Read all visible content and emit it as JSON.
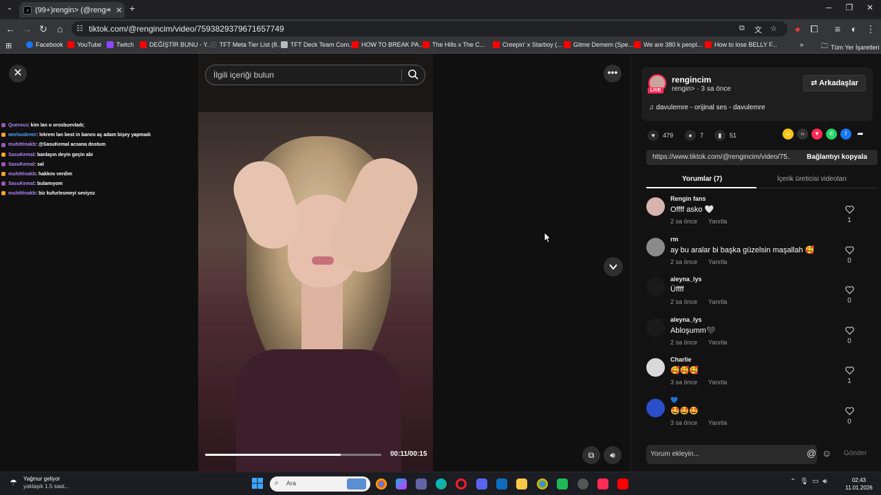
{
  "browser": {
    "tab_title": "(99+)rengin> (@rengincim",
    "url": "tiktok.com/@rengincim/video/7593829379671657749",
    "bookmarks": [
      "Facebook",
      "YouTube",
      "Twitch",
      "DEĞİŞTİR BUNU - Y...",
      "TFT Meta Tier List (8...",
      "TFT Deck Team Com...",
      "HOW TO BREAK PA...",
      "The Hills x The C...",
      "Creepin' x Starboy (...",
      "Gitme Demem (Spe...",
      "We are 380 k peopl...",
      "How to lose BELLY F..."
    ],
    "all_bookmarks": "Tüm Yer İşaretleri"
  },
  "video": {
    "search_placeholder": "İlgili içeriği bulun",
    "timecode": "00:11/00:15",
    "progress_fraction": 0.77
  },
  "chat": [
    {
      "user": "Queroxs",
      "msg": ": kim lan o orosbuevladı;",
      "color": "#b085f5"
    },
    {
      "user": "werlozdemir",
      "msg": ": lekrem lan best in banını aç adam bişey yapmadı",
      "color": "#4fa3ff"
    },
    {
      "user": "muhittinakb",
      "msg": ": @SasuKemal acsana dostum",
      "color": "#b085f5"
    },
    {
      "user": "SasuKemal",
      "msg": ": banlayın deyin geçin abi",
      "color": "#b085f5"
    },
    {
      "user": "SasuKemal",
      "msg": ": sal",
      "color": "#b085f5"
    },
    {
      "user": "muhittinakb",
      "msg": ": hakkını verdim",
      "color": "#b085f5"
    },
    {
      "user": "SasuKemal",
      "msg": ": bulamıyom",
      "color": "#b085f5"
    },
    {
      "user": "muhittinakb",
      "msg": ": biz kufurlesmeyi seviyoz",
      "color": "#b085f5"
    }
  ],
  "author": {
    "name": "rengincim",
    "subtitle": "rengin> · 3 sa önce",
    "live_badge": "LIVE",
    "friends_button": "Arkadaşlar",
    "music": "davulemre - orijinal ses - davulemre"
  },
  "stats": {
    "likes": "479",
    "comments": "7",
    "saves": "51"
  },
  "link": {
    "url": "https://www.tiktok.com/@rengincim/video/75...",
    "copy_button": "Bağlantıyı kopyala"
  },
  "tabs": {
    "comments": "Yorumlar (7)",
    "creator_videos": "İçerik üreticisi videoları"
  },
  "comments": [
    {
      "name": "Rengin fans",
      "text": "Offff asko 🤍",
      "time": "2 sa önce",
      "reply": "Yanıtla",
      "likes": "1",
      "avatar_color": "#d6b3ad"
    },
    {
      "name": "rm",
      "text": "ay bu aralar bi başka güzelsin maşallah 🥰",
      "time": "2 sa önce",
      "reply": "Yanıtla",
      "likes": "0",
      "avatar_color": "#8a8a8a"
    },
    {
      "name": "aleyna_lys",
      "text": "Üffff",
      "time": "2 sa önce",
      "reply": "Yanıtla",
      "likes": "0",
      "avatar_color": "#1a1a1a"
    },
    {
      "name": "aleyna_lys",
      "text": "Abloşumm🖤",
      "time": "2 sa önce",
      "reply": "Yanıtla",
      "likes": "0",
      "avatar_color": "#1a1a1a"
    },
    {
      "name": "Charlie",
      "text": "🥰🥰🥰",
      "time": "3 sa önce",
      "reply": "Yanıtla",
      "likes": "1",
      "avatar_color": "#d9d9d9"
    },
    {
      "name": "💙",
      "text": "🤩🤩🤩",
      "time": "3 sa önce",
      "reply": "Yanıtla",
      "likes": "0",
      "avatar_color": "#2b4ec9"
    }
  ],
  "comment_input": {
    "placeholder": "Yorum ekleyin...",
    "send": "Gönder"
  },
  "taskbar": {
    "weather_title": "Yağmur geliyor",
    "weather_sub": "yaklaşık 1.5 saat...",
    "search_placeholder": "Ara",
    "time": "02:43",
    "date": "11.01.2026"
  },
  "colors": {
    "tiktok_red": "#fe2c55",
    "panel_bg": "#121212"
  }
}
